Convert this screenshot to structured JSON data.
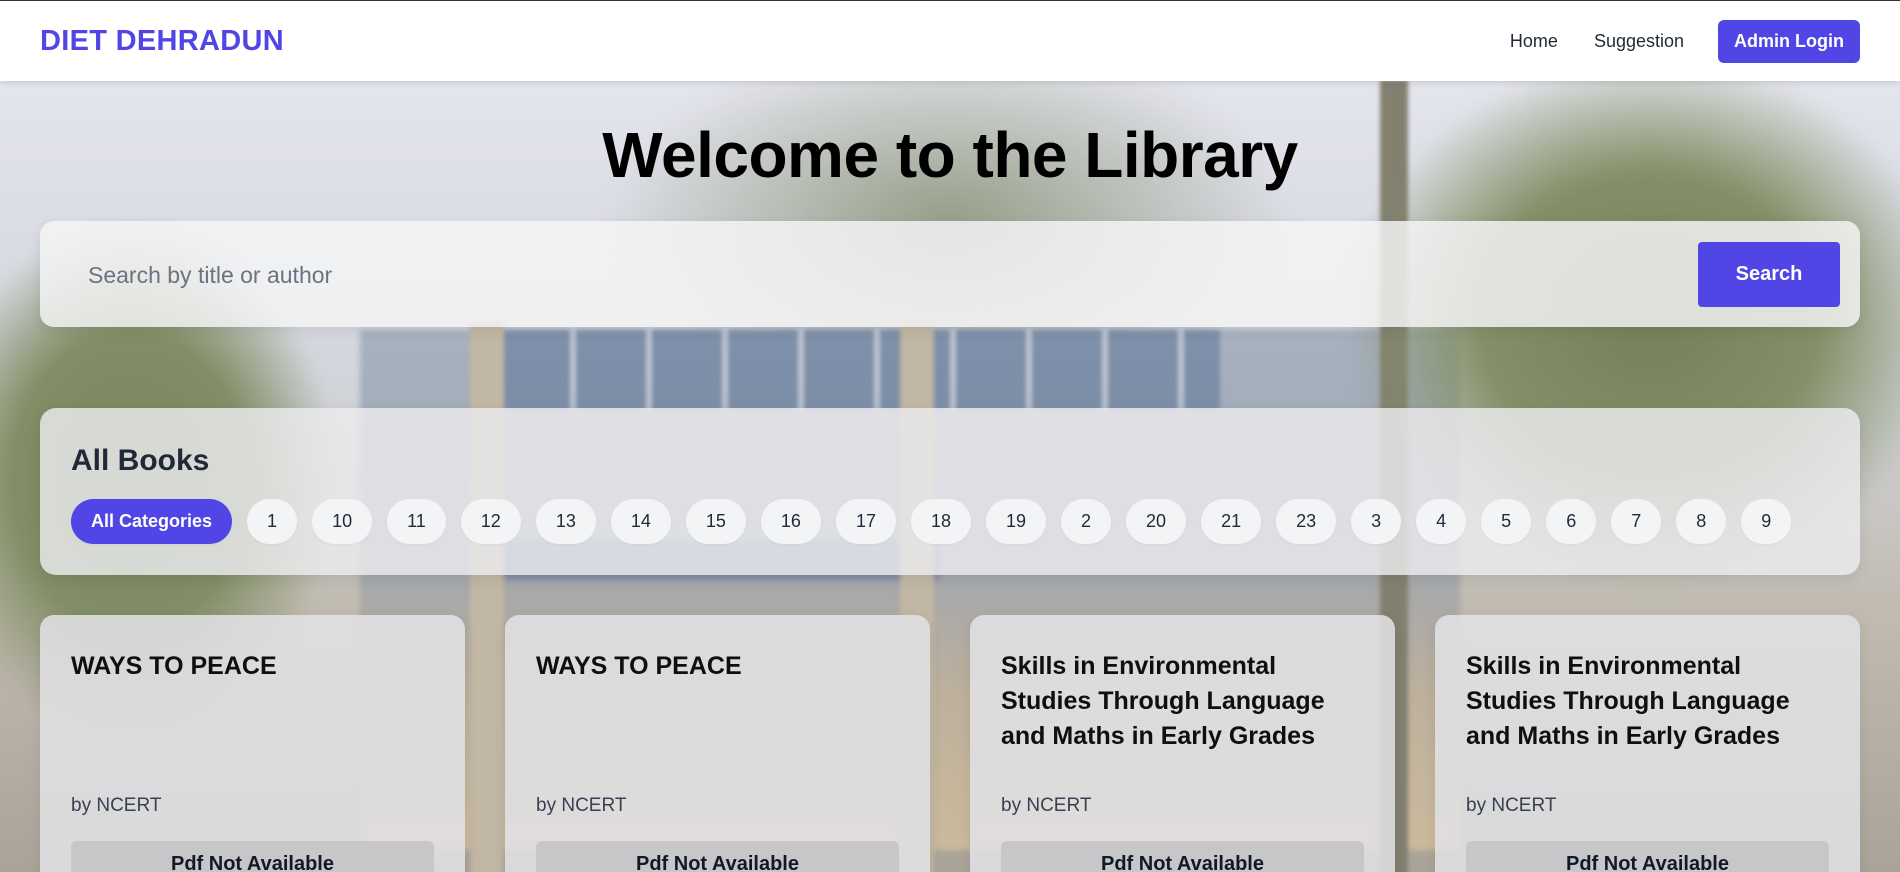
{
  "header": {
    "brand": "DIET DEHRADUN",
    "nav": [
      {
        "label": "Home"
      },
      {
        "label": "Suggestion"
      }
    ],
    "admin_login_label": "Admin Login"
  },
  "hero": {
    "title": "Welcome to the Library"
  },
  "search": {
    "placeholder": "Search by title or author",
    "value": "",
    "button_label": "Search"
  },
  "books_section": {
    "title": "All Books",
    "categories": [
      {
        "label": "All Categories",
        "selected": true
      },
      {
        "label": "1"
      },
      {
        "label": "10"
      },
      {
        "label": "11"
      },
      {
        "label": "12"
      },
      {
        "label": "13"
      },
      {
        "label": "14"
      },
      {
        "label": "15"
      },
      {
        "label": "16"
      },
      {
        "label": "17"
      },
      {
        "label": "18"
      },
      {
        "label": "19"
      },
      {
        "label": "2"
      },
      {
        "label": "20"
      },
      {
        "label": "21"
      },
      {
        "label": "23"
      },
      {
        "label": "3"
      },
      {
        "label": "4"
      },
      {
        "label": "5"
      },
      {
        "label": "6"
      },
      {
        "label": "7"
      },
      {
        "label": "8"
      },
      {
        "label": "9"
      }
    ]
  },
  "books": [
    {
      "title": "WAYS TO PEACE",
      "author": "by NCERT",
      "pdf_status": "Pdf Not Available"
    },
    {
      "title": "WAYS TO PEACE",
      "author": "by NCERT",
      "pdf_status": "Pdf Not Available"
    },
    {
      "title": "Skills in Environmental Studies Through Language and Maths in Early Grades",
      "author": "by NCERT",
      "pdf_status": "Pdf Not Available"
    },
    {
      "title": "Skills in Environmental Studies Through Language and Maths in Early Grades",
      "author": "by NCERT",
      "pdf_status": "Pdf Not Available"
    }
  ],
  "colors": {
    "accent": "#4f46e5",
    "chip_bg": "#f3f4f6",
    "text": "#1f2937"
  }
}
